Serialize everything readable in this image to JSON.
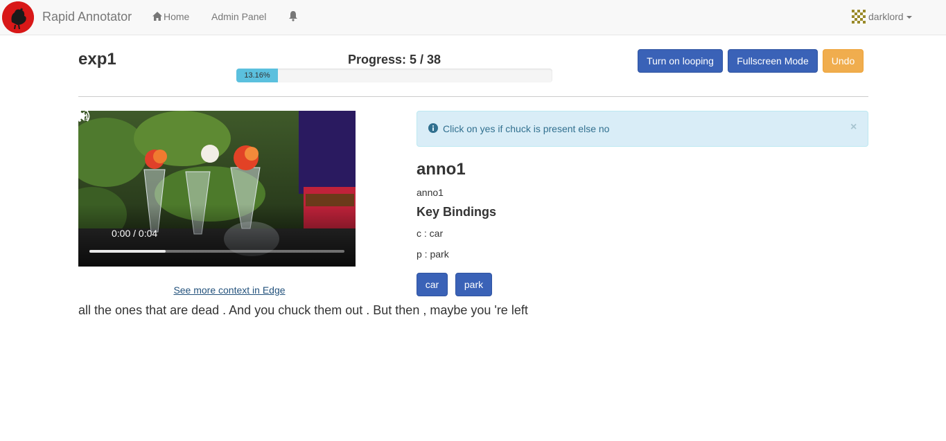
{
  "navbar": {
    "brand": "Rapid Annotator",
    "home": "Home",
    "admin": "Admin Panel",
    "user": "darklord"
  },
  "experiment": {
    "title": "exp1",
    "progress_label": "Progress: 5 / 38",
    "progress_percent": "13.16%",
    "progress_fraction": 0.1316
  },
  "toolbar": {
    "loop_label": "Turn on looping",
    "fullscreen_label": "Fullscreen Mode",
    "undo_label": "Undo"
  },
  "video": {
    "time": "0:00 / 0:04",
    "played_fraction": 0.3
  },
  "context_link": "See more context in Edge",
  "caption": "all the ones that are dead . And you chuck them out . But then , maybe you 're left",
  "alert": {
    "text": "Click on yes if chuck is present else no",
    "close": "×"
  },
  "annotation": {
    "title": "anno1",
    "subtitle": "anno1",
    "key_bindings_title": "Key Bindings",
    "bindings": [
      {
        "text": "c : car"
      },
      {
        "text": "p : park"
      }
    ],
    "buttons": [
      {
        "label": "car"
      },
      {
        "label": "park"
      }
    ]
  },
  "colors": {
    "primary": "#3a62b7",
    "warning": "#f0ad4e",
    "info_bg": "#d9edf7",
    "progress": "#5bc0de"
  }
}
